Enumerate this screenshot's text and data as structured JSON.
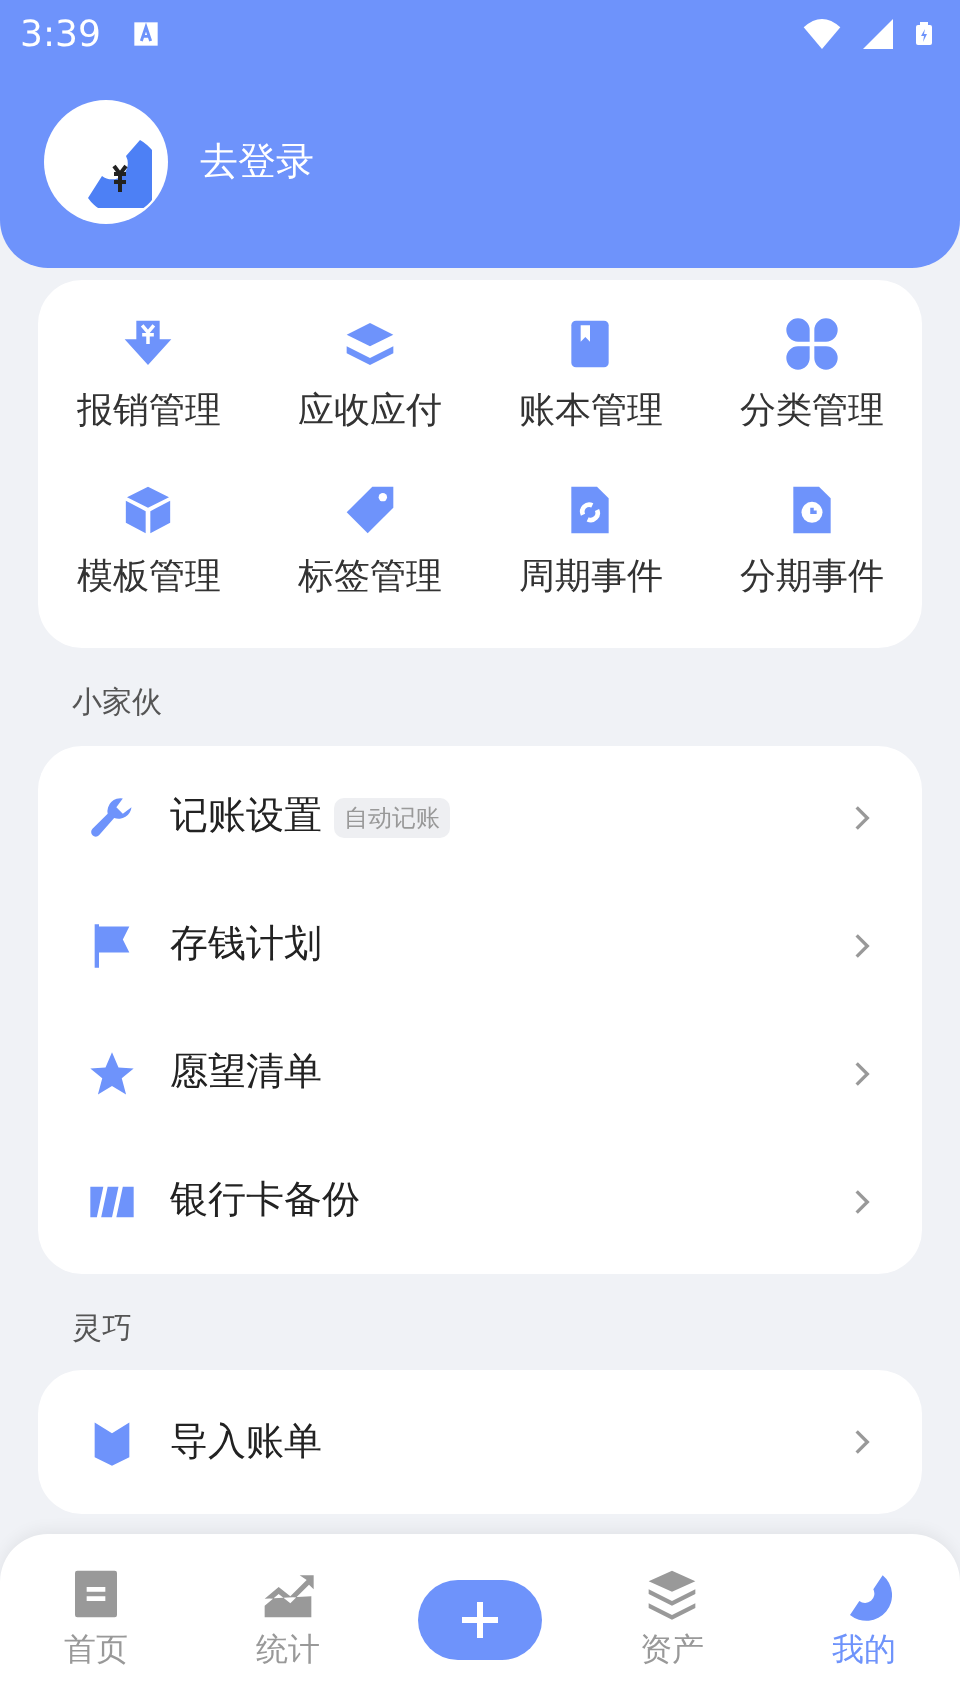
{
  "status_bar": {
    "time": "3:39"
  },
  "profile": {
    "login_text": "去登录"
  },
  "shortcuts": [
    {
      "label": "报销管理"
    },
    {
      "label": "应收应付"
    },
    {
      "label": "账本管理"
    },
    {
      "label": "分类管理"
    },
    {
      "label": "模板管理"
    },
    {
      "label": "标签管理"
    },
    {
      "label": "周期事件"
    },
    {
      "label": "分期事件"
    }
  ],
  "groups": [
    {
      "title": "小家伙",
      "items": [
        {
          "label": "记账设置",
          "tag": "自动记账"
        },
        {
          "label": "存钱计划"
        },
        {
          "label": "愿望清单"
        },
        {
          "label": "银行卡备份"
        }
      ]
    },
    {
      "title": "灵巧",
      "items": [
        {
          "label": "导入账单"
        }
      ]
    }
  ],
  "tab_bar": [
    {
      "kind": "tab",
      "label": "首页",
      "selected": false
    },
    {
      "kind": "tab",
      "label": "统计",
      "selected": false
    },
    {
      "kind": "add"
    },
    {
      "kind": "tab",
      "label": "资产",
      "selected": false
    },
    {
      "kind": "tab",
      "label": "我的",
      "selected": true
    }
  ]
}
